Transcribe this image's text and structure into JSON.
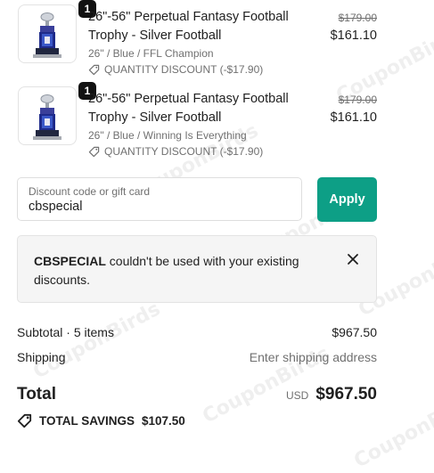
{
  "items": [
    {
      "quantity": "1",
      "name": "26\"-56\" Perpetual Fantasy Football Trophy - Silver Football",
      "variant": "26\" / Blue / FFL Champion",
      "discount": "QUANTITY DISCOUNT (-$17.90)",
      "original_price": "$179.00",
      "price": "$161.10"
    },
    {
      "quantity": "1",
      "name": "26\"-56\" Perpetual Fantasy Football Trophy - Silver Football",
      "variant": "26\" / Blue / Winning Is Everything",
      "discount": "QUANTITY DISCOUNT (-$17.90)",
      "original_price": "$179.00",
      "price": "$161.10"
    }
  ],
  "discount_field": {
    "label": "Discount code or gift card",
    "value": "cbspecial"
  },
  "apply_button": "Apply",
  "alert": {
    "code": "CBSPECIAL",
    "message": "couldn't be used with your existing discounts."
  },
  "summary": {
    "subtotal_label": "Subtotal · 5 items",
    "subtotal_value": "$967.50",
    "shipping_label": "Shipping",
    "shipping_value": "Enter shipping address",
    "total_label": "Total",
    "currency": "USD",
    "total_value": "$967.50",
    "savings_label": "TOTAL SAVINGS",
    "savings_value": "$107.50"
  },
  "watermark_text": "CouponBirds",
  "colors": {
    "accent": "#0d9f86",
    "muted": "#707070",
    "alert_bg": "#f5f5f5"
  }
}
